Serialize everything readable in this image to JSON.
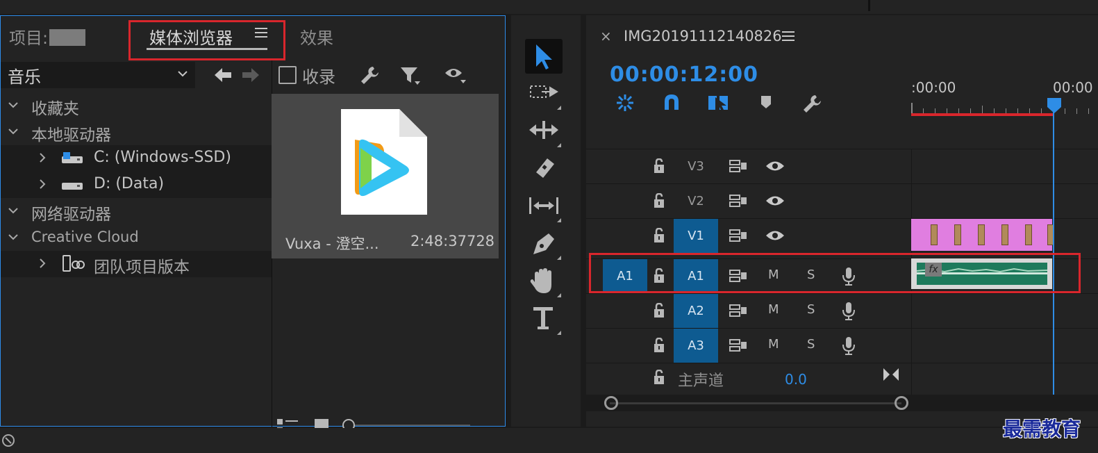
{
  "project_panel": {
    "tab_project": "项目:",
    "tab_media_browser": "媒体浏览器",
    "tab_effects": "效果",
    "location_select": "音乐",
    "favorite_label": "收录",
    "tree": [
      {
        "label": "收藏夹",
        "level": 0,
        "expanded": true
      },
      {
        "label": "本地驱动器",
        "level": 0,
        "expanded": true
      },
      {
        "label": "C: (Windows-SSD)",
        "level": 1,
        "expanded": false,
        "icon": "windows-drive-icon"
      },
      {
        "label": "D: (Data)",
        "level": 1,
        "expanded": false,
        "icon": "hard-drive-icon"
      },
      {
        "label": "网络驱动器",
        "level": 0,
        "expanded": true
      },
      {
        "label": "Creative Cloud",
        "level": 0,
        "expanded": true
      },
      {
        "label": "团队项目版本",
        "level": 1,
        "expanded": false,
        "icon": "team-project-icon"
      }
    ],
    "media_item": {
      "name": "Vuxa - 澄空...",
      "duration": "2:48:37728"
    }
  },
  "timeline": {
    "sequence_name": "IMG20191112140826",
    "close_glyph": "×",
    "timecode": "00:00:12:00",
    "ruler_labels": [
      ":00:00",
      "00:00"
    ],
    "video_tracks": [
      {
        "name": "V3",
        "targeted": false
      },
      {
        "name": "V2",
        "targeted": false
      },
      {
        "name": "V1",
        "targeted": true
      }
    ],
    "audio_tracks": [
      {
        "name": "A1",
        "source": "A1",
        "targeted": true
      },
      {
        "name": "A2",
        "targeted": true
      },
      {
        "name": "A3",
        "targeted": true
      }
    ],
    "mute_label": "M",
    "solo_label": "S",
    "master": {
      "label": "主声道",
      "value": "0.0"
    },
    "fx_badge": "fx"
  },
  "watermark": "最需教育",
  "colors": {
    "accent_blue": "#2e8de6",
    "track_target": "#0e5b91",
    "highlight_red": "#d9262c",
    "video_clip": "#e07ee0",
    "audio_wave": "#1e7a5c"
  }
}
